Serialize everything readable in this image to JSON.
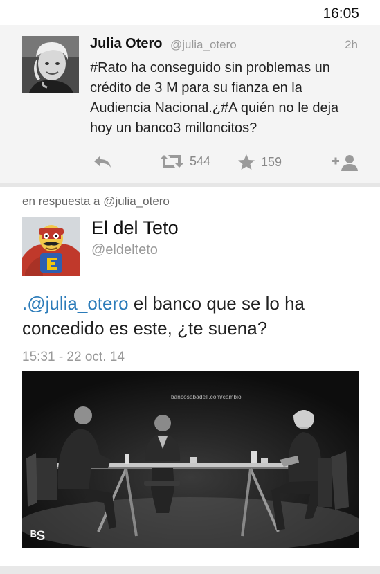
{
  "status": {
    "time": "16:05"
  },
  "tweet": {
    "author_name": "Julia Otero",
    "author_handle": "@julia_otero",
    "age": "2h",
    "text": "#Rato ha conseguido sin problemas un crédito de 3 M para su fianza en la Audiencia Nacional.¿#A quién no le deja hoy un banco3 milloncitos?",
    "actions": {
      "reply_icon": "reply-icon",
      "retweet_icon": "retweet-icon",
      "retweet_count": "544",
      "favorite_icon": "star-icon",
      "favorite_count": "159",
      "follow_icon": "follow-user-icon"
    }
  },
  "reply": {
    "context": "en respuesta a @julia_otero",
    "author_name": "El del Teto",
    "author_handle": "@eldelteto",
    "mention": ".@julia_otero",
    "text": " el banco que se lo ha concedido es este, ¿te suena?",
    "timestamp": "15:31 - 22 oct. 14"
  },
  "photo": {
    "watermark_url": "bancosabadell.com/cambio",
    "logo": "ᴮS"
  },
  "colors": {
    "link": "#2b7bb9",
    "muted": "#999999",
    "card_bg": "#f4f4f4"
  }
}
